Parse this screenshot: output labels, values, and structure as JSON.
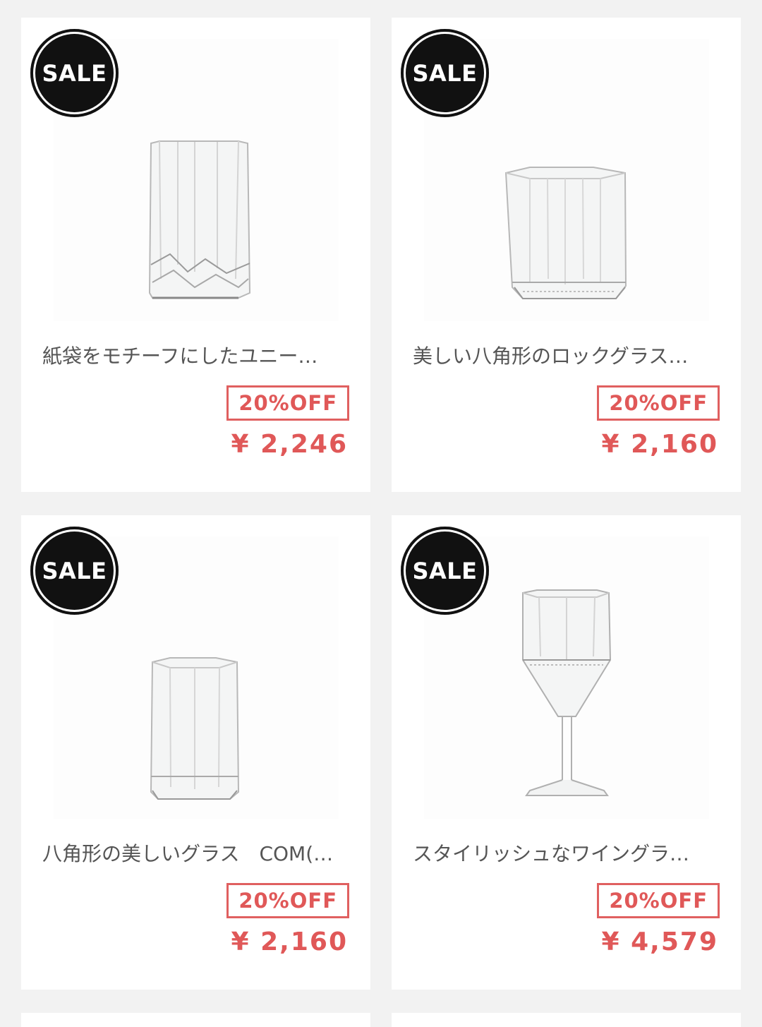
{
  "products": [
    {
      "badge": "SALE",
      "image_icon": "tall-faceted-tumbler-image",
      "title": "紙袋をモチーフにしたユニー…",
      "discount": "20%OFF",
      "price": "¥ 2,246"
    },
    {
      "badge": "SALE",
      "image_icon": "octagonal-rock-glass-image",
      "title": "美しい八角形のロックグラス…",
      "discount": "20%OFF",
      "price": "¥ 2,160"
    },
    {
      "badge": "SALE",
      "image_icon": "octagonal-tumbler-image",
      "title": "八角形の美しいグラス　COM(…",
      "discount": "20%OFF",
      "price": "¥ 2,160"
    },
    {
      "badge": "SALE",
      "image_icon": "octagonal-wine-glass-image",
      "title": "スタイリッシュなワイングラ…",
      "discount": "20%OFF",
      "price": "¥ 4,579"
    }
  ],
  "colors": {
    "page_background": "#f2f2f2",
    "card_background": "#ffffff",
    "sale_red": "#e05858",
    "badge_black": "#111111",
    "title_gray": "#555555"
  }
}
